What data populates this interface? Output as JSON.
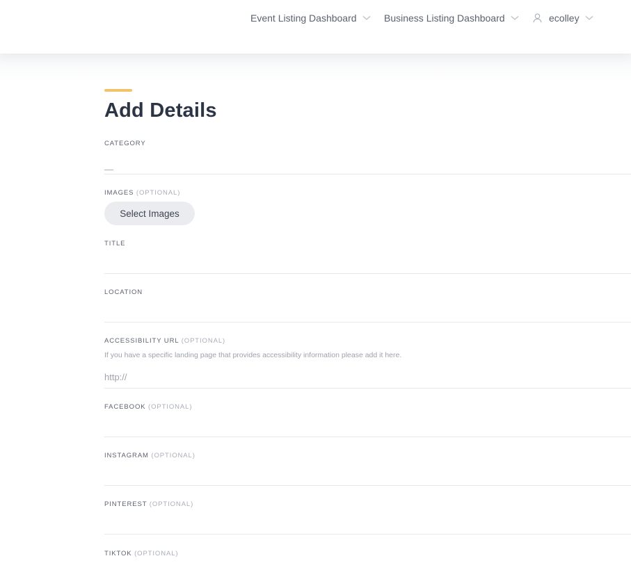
{
  "nav": {
    "events": "Event Listing Dashboard",
    "business": "Business Listing Dashboard",
    "username": "ecolley"
  },
  "page": {
    "title": "Add Details"
  },
  "form": {
    "category": {
      "label": "Category",
      "value": "—"
    },
    "images": {
      "label": "Images",
      "optional": "(Optional)",
      "button": "Select Images"
    },
    "title": {
      "label": "Title",
      "value": ""
    },
    "location": {
      "label": "Location",
      "value": ""
    },
    "accessibility": {
      "label": "Accessibility URL",
      "optional": "(Optional)",
      "help": "If you have a specific landing page that provides accessibility information please add it here.",
      "placeholder": "http://"
    },
    "facebook": {
      "label": "Facebook",
      "optional": "(Optional)"
    },
    "instagram": {
      "label": "Instagram",
      "optional": "(Optional)"
    },
    "pinterest": {
      "label": "Pinterest",
      "optional": "(Optional)"
    },
    "tiktok": {
      "label": "TikTok",
      "optional": "(Optional)"
    }
  },
  "colors": {
    "accent": "#f2c36b",
    "title": "#2c3545",
    "divider": "#e6e8ec"
  }
}
